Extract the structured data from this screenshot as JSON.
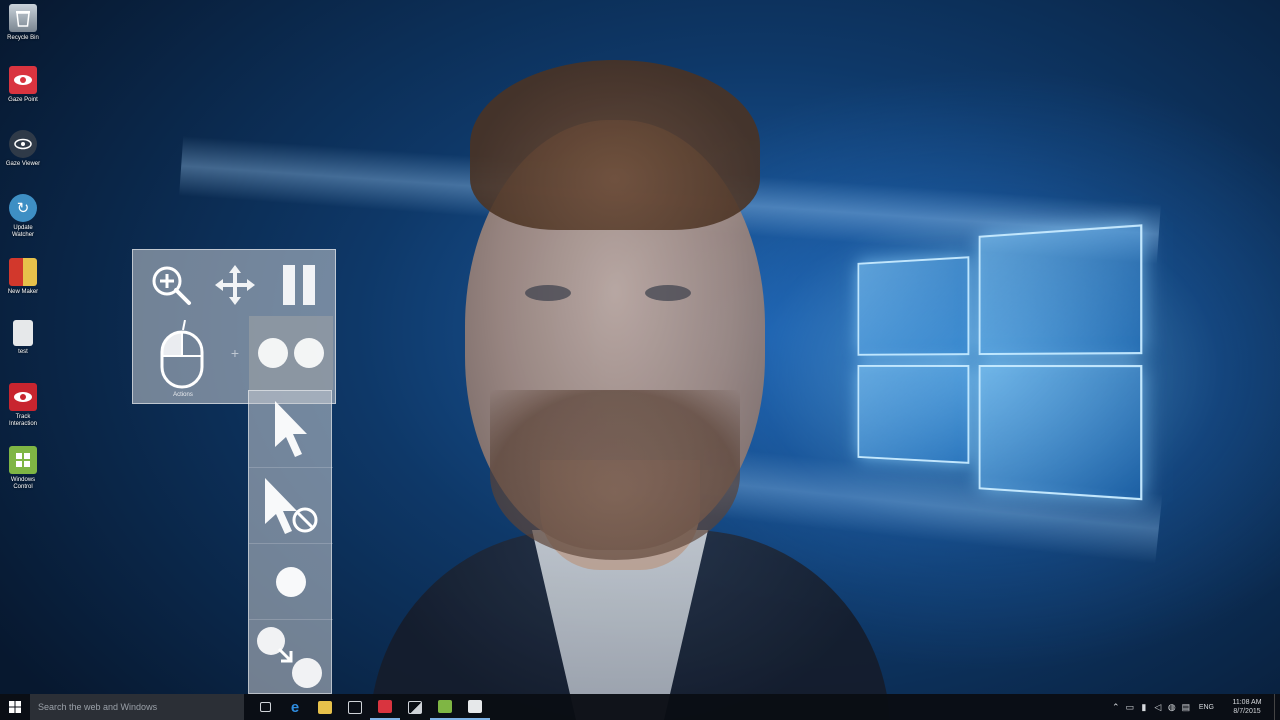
{
  "desktop": {
    "icons": [
      {
        "label": "Recycle Bin",
        "icon": "recycle-bin-icon",
        "color": "#7a8590"
      },
      {
        "label": "Gaze Point",
        "icon": "eye-icon",
        "color": "#d9343f"
      },
      {
        "label": "Gaze Viewer",
        "icon": "viewer-icon",
        "color": "#2f3a48"
      },
      {
        "label": "Update Watcher",
        "icon": "refresh-icon",
        "color": "#3e8fc4"
      },
      {
        "label": "New Maker",
        "icon": "document-icon",
        "color": "#d2382c"
      },
      {
        "label": "test",
        "icon": "file-icon",
        "color": "#e6e8ea"
      },
      {
        "label": "Track Interaction",
        "icon": "eye-icon",
        "color": "#c8252f"
      },
      {
        "label": "Windows Control",
        "icon": "windows-control-icon",
        "color": "#7fb644"
      }
    ]
  },
  "toolbar": {
    "mouse_label": "Actions",
    "tools": [
      "zoom-in",
      "pan",
      "pause",
      "mouse",
      "dual-click"
    ],
    "submenu": [
      "cursor",
      "cursor-disabled",
      "single-click",
      "drag"
    ]
  },
  "taskbar": {
    "search_placeholder": "Search the web and Windows",
    "apps": [
      {
        "name": "task-view",
        "color": "#cfd3d8"
      },
      {
        "name": "edge",
        "color": "#2f8de0"
      },
      {
        "name": "file-explorer",
        "color": "#e7c14b"
      },
      {
        "name": "store",
        "color": "#cfd3d8"
      },
      {
        "name": "app-red",
        "color": "#d9343f"
      },
      {
        "name": "photos",
        "color": "#cfd3d8"
      },
      {
        "name": "windows-control",
        "color": "#7fb644"
      },
      {
        "name": "app-white",
        "color": "#e6e8ea"
      }
    ],
    "language": "ENG",
    "time": "11:08 AM",
    "date": "8/7/2015"
  }
}
